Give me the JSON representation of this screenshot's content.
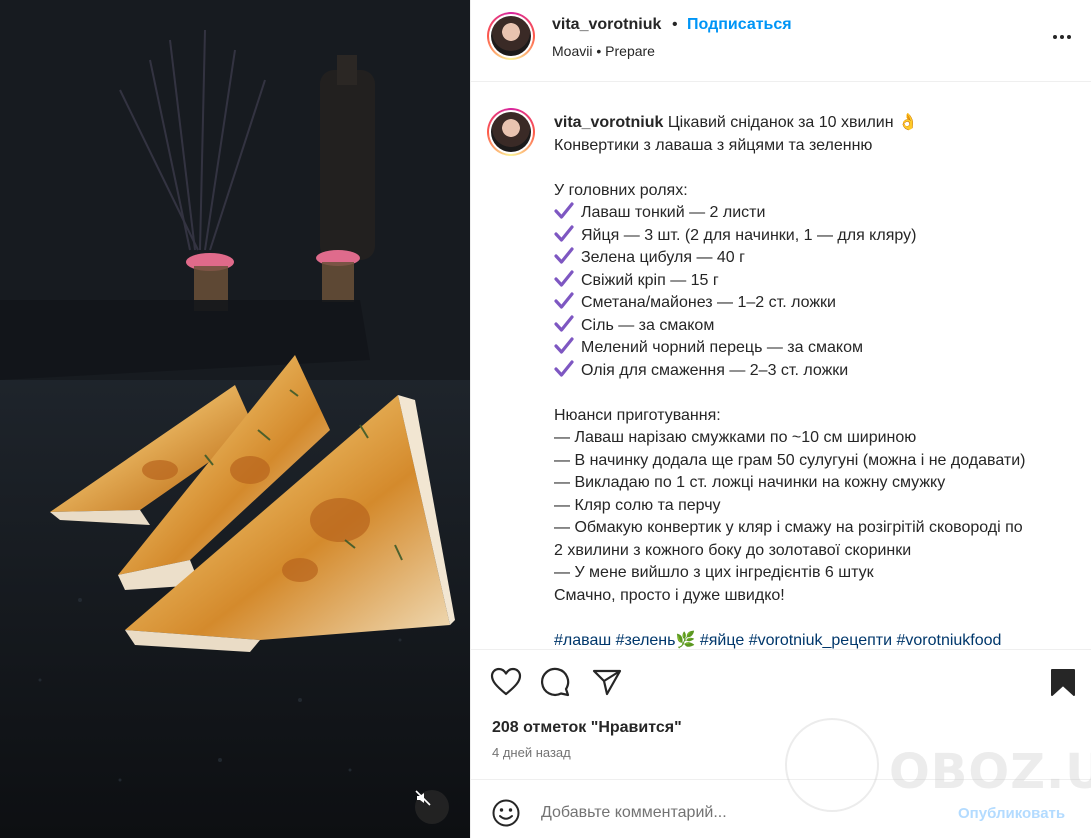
{
  "post": {
    "username": "vita_vorotniuk",
    "separator": "•",
    "follow_label": "Подписаться",
    "location": "Moavii",
    "location_separator": "•",
    "audio": "Prepare"
  },
  "caption": {
    "username": "vita_vorotniuk",
    "title": "Цікавий сніданок за 10 хвилин",
    "title_emoji": "👌",
    "subtitle": "Конвертики з лаваша з яйцями та зеленню",
    "ingredients_heading": "У головних ролях:",
    "ingredients": [
      "Лаваш тонкий — 2 листи",
      "Яйця — 3 шт. (2 для начинки, 1 — для кляру)",
      "Зелена цибуля — 40 г",
      "Свіжий кріп — 15 г",
      "Сметана/майонез — 1–2 ст. ложки",
      "Сіль — за смаком",
      "Мелений чорний перець — за смаком",
      "Олія для смаження — 2–3 ст. ложки"
    ],
    "steps_heading": "Нюанси приготування:",
    "steps": [
      "— Лаваш нарізаю смужками по ~10 см шириною",
      "— В начинку додала ще грам 50 сулугуні (можна і не додавати)",
      "— Викладаю по 1 ст. ложці начинки на кожну смужку",
      "— Кляр солю та перчу",
      "— Обмакую конвертик у кляр і смажу на розігрітій сковороді по",
      "2 хвилини з кожного боку до золотавої скоринки",
      "— У мене вийшло з цих інгредієнтів 6 штук",
      "Смачно, просто і дуже швидко!"
    ],
    "hashtags": [
      "#лаваш",
      "#зелень🌿",
      "#яйце",
      "#vorotniuk_рецепти",
      "#vorotniukfood"
    ]
  },
  "engagement": {
    "likes": "208 отметок \"Нравится\"",
    "time": "4 дней назад"
  },
  "comment": {
    "placeholder": "Добавьте комментарий...",
    "publish_label": "Опубликовать"
  },
  "watermark": "OBOZ.UA",
  "colors": {
    "link_blue": "#0095f6",
    "hashtag_blue": "#00376b",
    "check_purple": "#7e57c2",
    "text": "#262626",
    "muted": "#737373"
  }
}
